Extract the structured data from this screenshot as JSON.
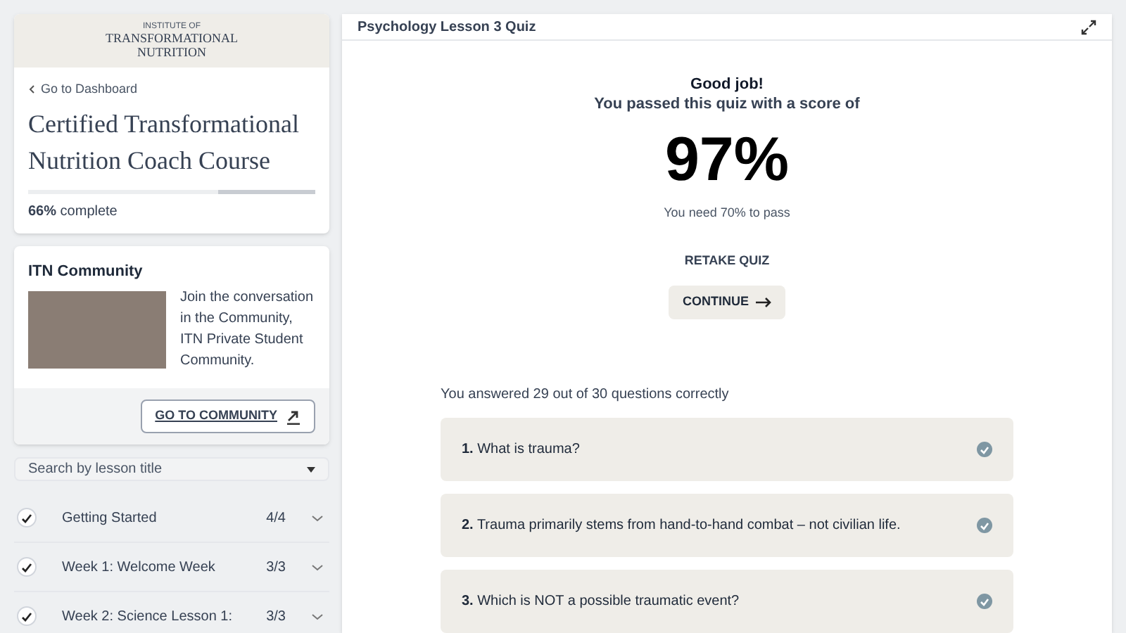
{
  "sidebar": {
    "logo": {
      "kicker": "INSTITUTE OF",
      "line_1": "TRANSFORMATIONAL",
      "line_2": "NUTRITION"
    },
    "back_link": "Go to Dashboard",
    "course_title": "Certified Transformational Nutrition Coach Course",
    "progress": {
      "level": 0.66,
      "percent": "66%",
      "label": "complete"
    },
    "community": {
      "title": "ITN Community",
      "text": "Join the conversation in the Community, ITN Private Student Community.",
      "button": "GO TO COMMUNITY"
    },
    "search": {
      "placeholder": "Search by lesson title"
    },
    "lessons": [
      {
        "title": "Getting Started",
        "count": "4/4",
        "checked": true
      },
      {
        "title": "Week 1: Welcome Week",
        "count": "3/3",
        "checked": true
      },
      {
        "title": "Week 2: Science Lesson 1:",
        "count": "3/3",
        "checked": true
      }
    ]
  },
  "quiz": {
    "title": "Psychology Lesson 3 Quiz",
    "heading": "Good job!",
    "subheading": "You passed this quiz with a score of",
    "score": "97%",
    "pass_note": "You need 70% to pass",
    "retake": "RETAKE QUIZ",
    "continue": "CONTINUE",
    "summary": "You answered 29 out of 30 questions correctly",
    "questions": [
      {
        "text": "**1.** What is trauma?",
        "correct": true
      },
      {
        "text": "**2.** Trauma primarily stems from hand-to-hand combat – not civilian life.",
        "correct": true
      },
      {
        "text": "**3.** Which is NOT a possible traumatic event?",
        "correct": true
      }
    ]
  }
}
